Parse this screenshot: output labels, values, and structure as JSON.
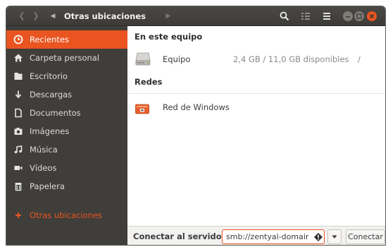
{
  "window": {
    "breadcrumb": "Otras ubicaciones"
  },
  "sidebar": {
    "items": [
      {
        "label": "Recientes",
        "icon": "clock-icon"
      },
      {
        "label": "Carpeta personal",
        "icon": "home-icon"
      },
      {
        "label": "Escritorio",
        "icon": "desktop-folder-icon"
      },
      {
        "label": "Descargas",
        "icon": "download-icon"
      },
      {
        "label": "Documentos",
        "icon": "document-icon"
      },
      {
        "label": "Imágenes",
        "icon": "camera-icon"
      },
      {
        "label": "Música",
        "icon": "music-icon"
      },
      {
        "label": "Vídeos",
        "icon": "video-icon"
      },
      {
        "label": "Papelera",
        "icon": "trash-icon"
      },
      {
        "label": "Otras ubicaciones",
        "icon": "plus-icon"
      }
    ]
  },
  "main": {
    "this_computer_header": "En este equipo",
    "computer": {
      "name": "Equipo",
      "info": "2,4 GB / 11,0 GB disponibles",
      "mount": "/"
    },
    "networks_header": "Redes",
    "network": {
      "name": "Red de Windows"
    }
  },
  "connect": {
    "label": "Conectar al servidor",
    "value": "smb://zentyal-domain",
    "button": "Conectar"
  },
  "colors": {
    "accent": "#e95420",
    "headerbar": "#3c3b37",
    "sidebar": "#3f3e3a"
  }
}
